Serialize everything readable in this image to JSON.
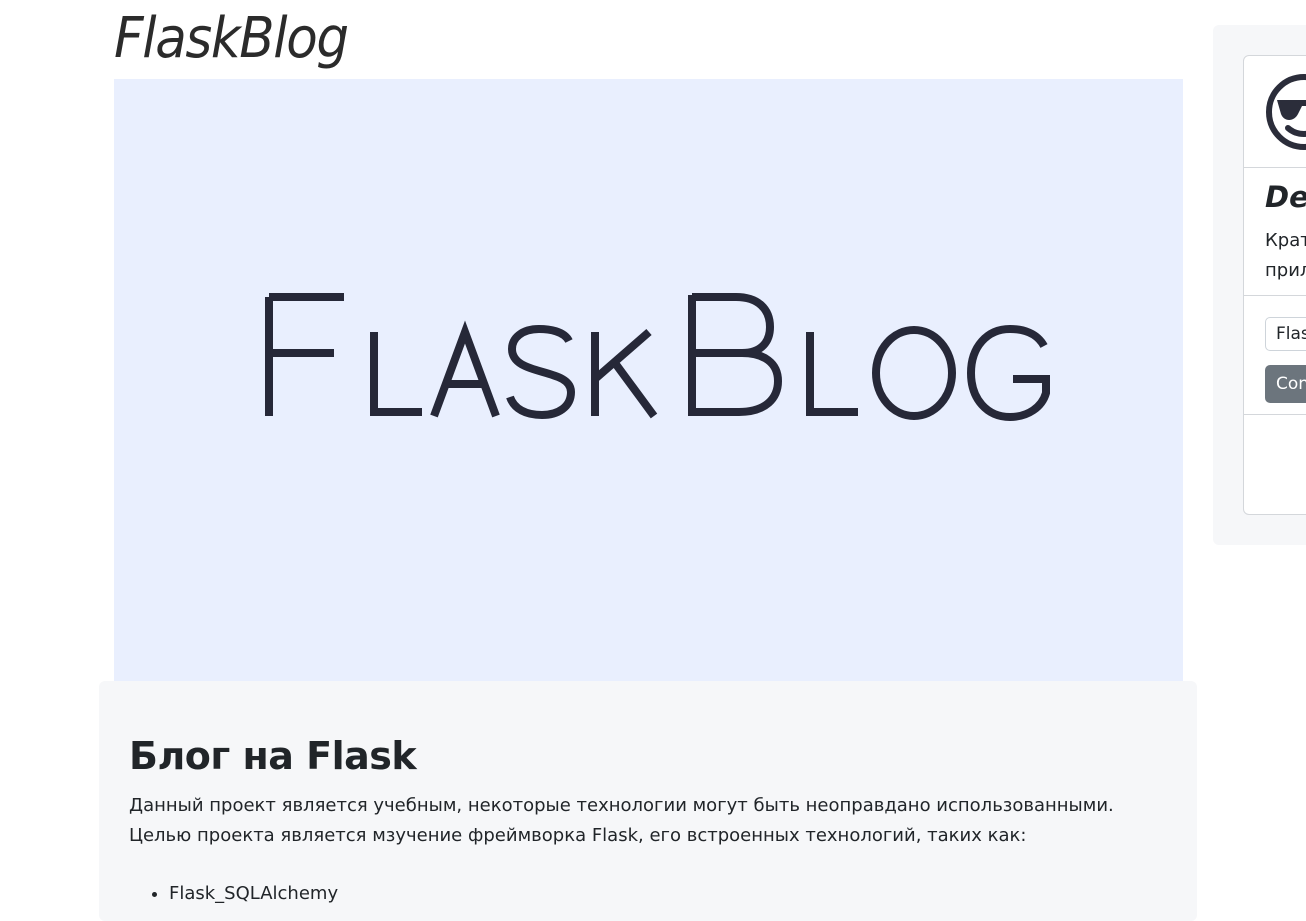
{
  "header": {
    "site_title": "FlaskBlog"
  },
  "banner": {
    "logo_text": "FlaskBlog",
    "background": "#e9effe",
    "logo_color": "#262838"
  },
  "main": {
    "title": "Блог на Flask",
    "description": "Данный проект является учебным, некоторые технологии могут быть неоправдано использованными. Целью проекта является мзучение фреймворка Flask, его встроенных технологий, таких как:",
    "tech_list": [
      "Flask_SQLAlchemy"
    ]
  },
  "sidebar": {
    "avatar_icon": "sunglasses-smiley-icon",
    "heading": "Des",
    "desc_line1": "Крат",
    "desc_line2": "прил",
    "search": {
      "value": "Flas"
    },
    "button_label": "Con"
  }
}
